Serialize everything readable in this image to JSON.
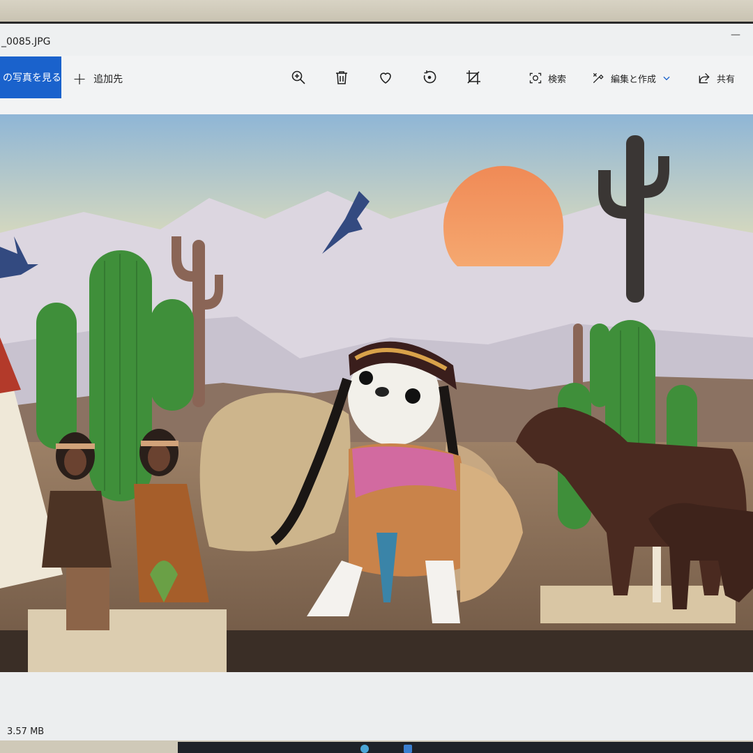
{
  "window": {
    "title": "_0085.JPG",
    "minimize_glyph": "—"
  },
  "toolbar": {
    "view_photos_label": "の写真を見る",
    "add_to_label": "追加先",
    "search_label": "検索",
    "edit_create_label": "編集と作成",
    "share_label": "共有",
    "icons": [
      "zoom-in-icon",
      "delete-icon",
      "heart-icon",
      "rotate-icon",
      "crop-icon"
    ]
  },
  "status": {
    "file_size": "3.57 MB"
  },
  "colors": {
    "accent": "#1a62cc",
    "sky_top": "#8fb6d6",
    "sun": "#f0905a",
    "cactus": "#3f8f3a",
    "ground": "#7e6652"
  }
}
